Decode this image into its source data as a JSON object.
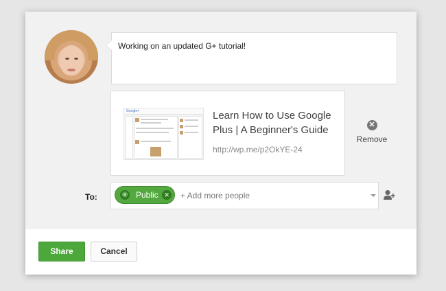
{
  "post": {
    "text": "Working on an updated G+ tutorial!"
  },
  "link_preview": {
    "title": "Learn How to Use Google Plus | A Beginner's Guide",
    "url": "http://wp.me/p2OkYE-24",
    "remove_label": "Remove",
    "thumbnail_logo": "Google+"
  },
  "audience": {
    "to_label": "To:",
    "chips": [
      {
        "label": "Public",
        "icon": "globe-icon"
      }
    ],
    "placeholder": "+ Add more people",
    "add_person_icon": "add-person-icon"
  },
  "actions": {
    "share_label": "Share",
    "cancel_label": "Cancel"
  },
  "colors": {
    "share_green": "#4ca83b",
    "chip_green": "#53a93f",
    "background": "#f1f1f1"
  }
}
